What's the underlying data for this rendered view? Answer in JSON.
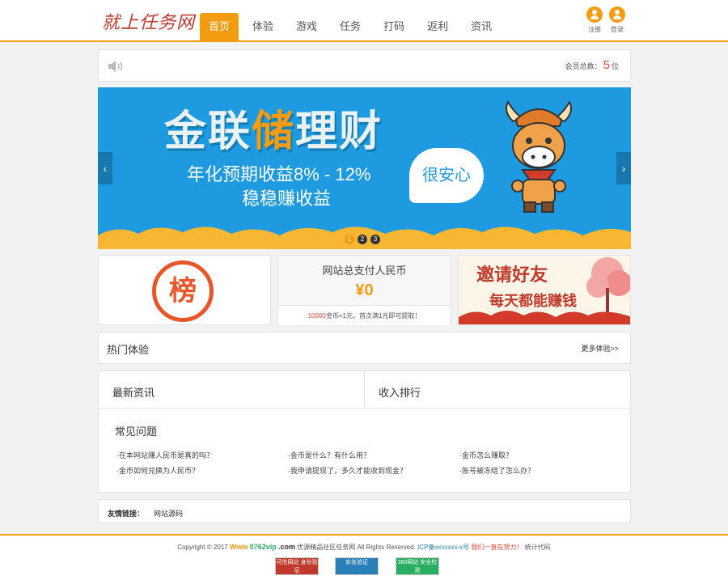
{
  "header": {
    "logo_text": "就上任务网",
    "nav": [
      "首页",
      "体验",
      "游戏",
      "任务",
      "打码",
      "返利",
      "资讯"
    ],
    "register_label": "注册",
    "login_label": "登录"
  },
  "notice": {
    "members_label": "会员总数：",
    "members_count": "5",
    "members_unit": "位"
  },
  "banner": {
    "title_part1": "金联",
    "title_highlight": "储",
    "title_part2": "理财",
    "subtitle1": "年化预期收益8% - 12%",
    "subtitle2": "稳稳赚收益",
    "bubble_text": "很安心",
    "prev_arrow": "‹",
    "next_arrow": "›",
    "dots": [
      "1",
      "2",
      "3"
    ]
  },
  "ranking": {
    "label": "榜"
  },
  "payout": {
    "title": "网站总支付人民币",
    "amount": "¥0",
    "note_red": "10000",
    "note_rest": "金币=1元，首次满1元即可提取！"
  },
  "invite": {
    "line1": "邀请好友",
    "line2": "每天都能赚钱"
  },
  "hot": {
    "title": "热门体验",
    "more": "更多体验>>"
  },
  "panels": {
    "news_title": "最新资讯",
    "rank_title": "收入排行",
    "faq_title": "常见问题"
  },
  "faq": [
    "·在本网站赚人民币是真的吗？",
    "·金币是什么？有什么用？",
    "·金币怎么赚取？",
    "·金币如何兑换为人民币？",
    "·我申请提现了，多久才能收到现金？",
    "·账号被冻结了怎么办？"
  ],
  "friend_links": {
    "label": "友情链接：",
    "items": [
      "网站源码"
    ]
  },
  "footer": {
    "copyright": "Copyright © 2017",
    "brand_www": "Www",
    "brand_domain": "0762vip",
    "brand_com": ".com",
    "site_name": "优源精品社区任务网 All Rights Reserved.",
    "icp": "ICP备xxxxxxx-x号",
    "slogan": "我们一直在努力！",
    "stats": "统计代码",
    "badges": [
      "可信网站 身份验证",
      "实名验证",
      "360网站 安全检测"
    ]
  },
  "colors": {
    "accent": "#f39c12",
    "banner_bg": "#1e9be0",
    "rank_red": "#e8572a"
  }
}
